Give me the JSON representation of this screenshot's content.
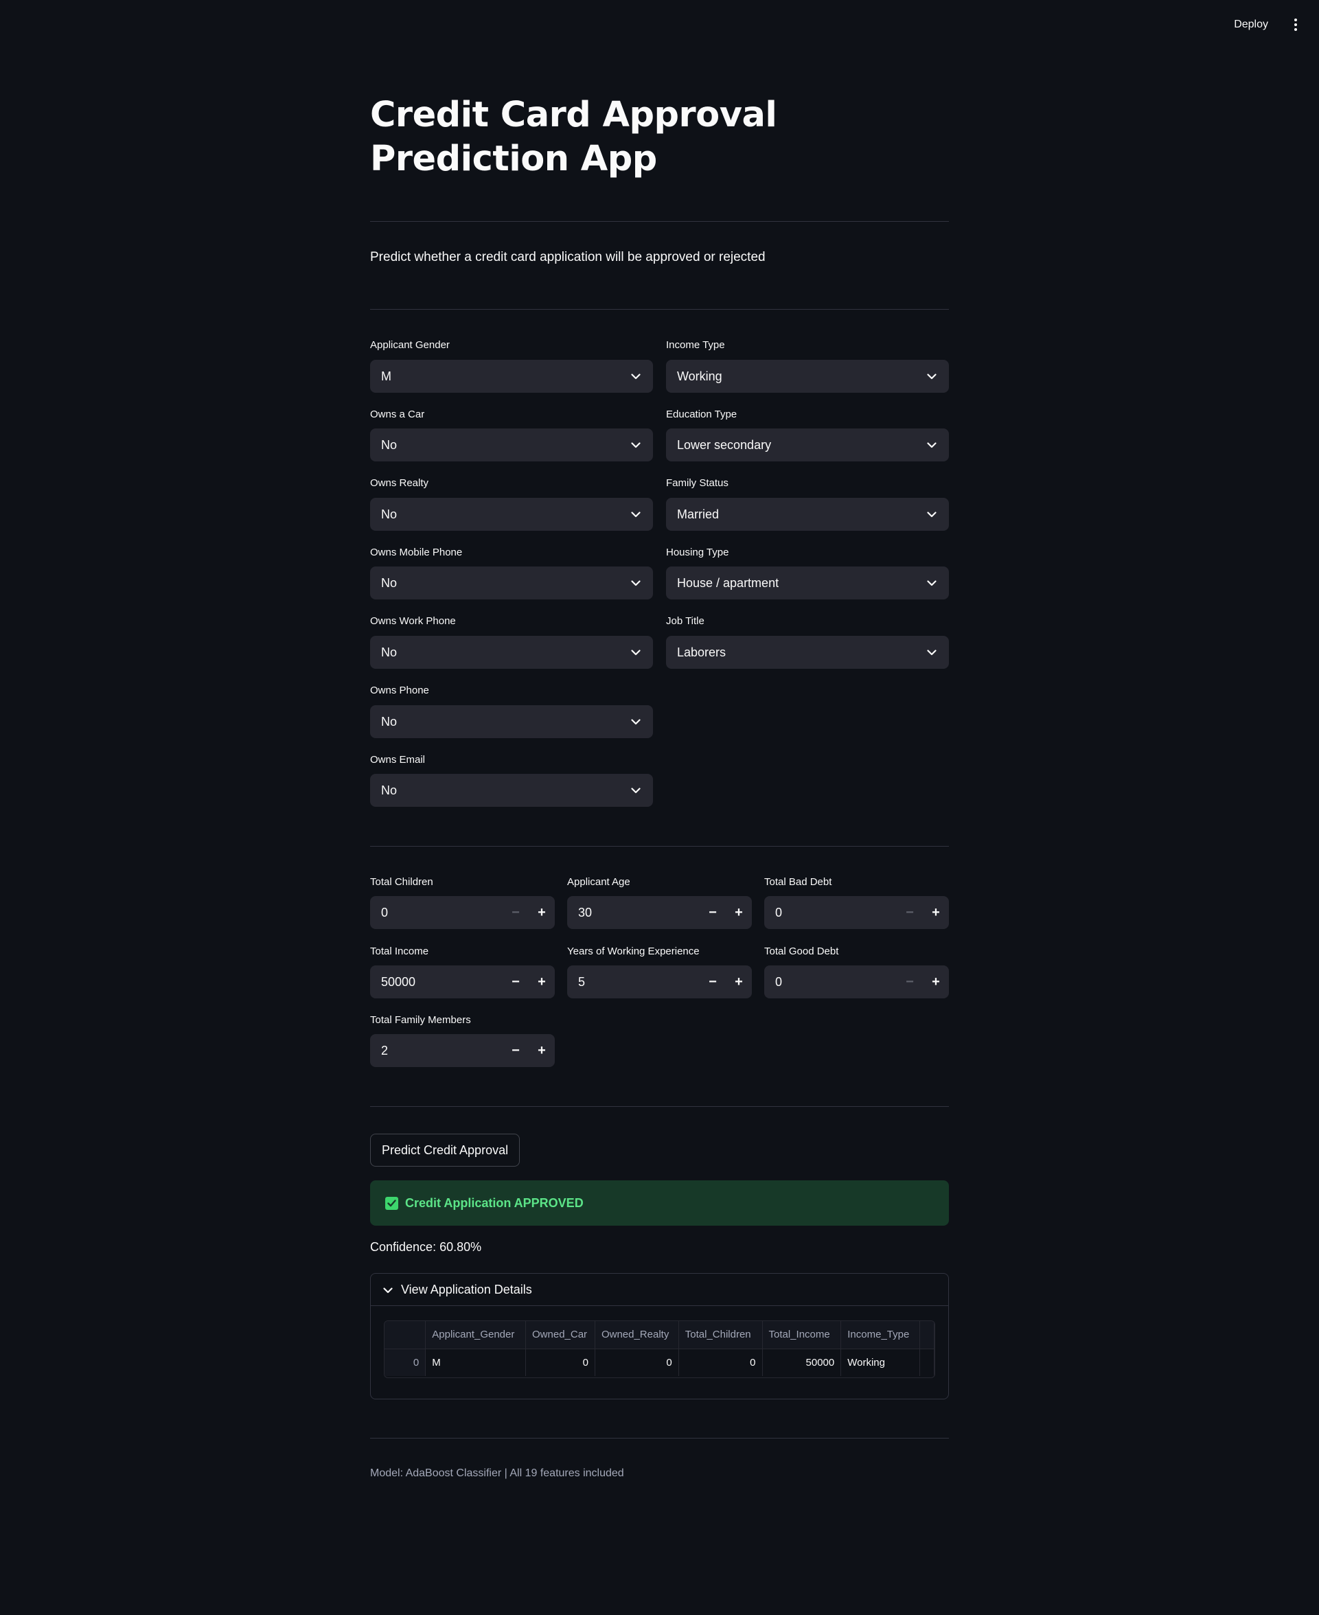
{
  "header": {
    "deploy_label": "Deploy",
    "menu_icon": "kebab-menu-icon"
  },
  "page": {
    "title": "Credit Card Approval Prediction App",
    "subtitle": "Predict whether a credit card application will be approved or rejected"
  },
  "selects": {
    "applicant_gender": {
      "label": "Applicant Gender",
      "value": "M"
    },
    "owns_car": {
      "label": "Owns a Car",
      "value": "No"
    },
    "owns_realty": {
      "label": "Owns Realty",
      "value": "No"
    },
    "owns_mobile_phone": {
      "label": "Owns Mobile Phone",
      "value": "No"
    },
    "owns_work_phone": {
      "label": "Owns Work Phone",
      "value": "No"
    },
    "owns_phone": {
      "label": "Owns Phone",
      "value": "No"
    },
    "owns_email": {
      "label": "Owns Email",
      "value": "No"
    },
    "income_type": {
      "label": "Income Type",
      "value": "Working"
    },
    "education_type": {
      "label": "Education Type",
      "value": "Lower secondary"
    },
    "family_status": {
      "label": "Family Status",
      "value": "Married"
    },
    "housing_type": {
      "label": "Housing Type",
      "value": "House / apartment"
    },
    "job_title": {
      "label": "Job Title",
      "value": "Laborers"
    }
  },
  "numbers": {
    "total_children": {
      "label": "Total Children",
      "value": "0"
    },
    "applicant_age": {
      "label": "Applicant Age",
      "value": "30"
    },
    "total_bad_debt": {
      "label": "Total Bad Debt",
      "value": "0"
    },
    "total_income": {
      "label": "Total Income",
      "value": "50000"
    },
    "years_experience": {
      "label": "Years of Working Experience",
      "value": "5"
    },
    "total_good_debt": {
      "label": "Total Good Debt",
      "value": "0"
    },
    "total_family_members": {
      "label": "Total Family Members",
      "value": "2"
    }
  },
  "stepper": {
    "minus": "−",
    "plus": "+"
  },
  "predict_button": "Predict Credit Approval",
  "result": {
    "message": "Credit Application APPROVED",
    "confidence": "Confidence: 60.80%",
    "success_color": "#5ce488",
    "background_color": "#173928"
  },
  "details": {
    "expander_label": "View Application Details",
    "columns": [
      "",
      "Applicant_Gender",
      "Owned_Car",
      "Owned_Realty",
      "Total_Children",
      "Total_Income",
      "Income_Type"
    ],
    "row": [
      "0",
      "M",
      "0",
      "0",
      "0",
      "50000",
      "Working"
    ]
  },
  "footer": "Model: AdaBoost Classifier | All 19 features included"
}
